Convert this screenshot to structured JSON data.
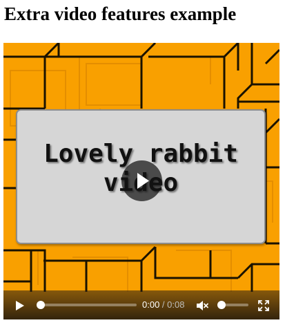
{
  "page": {
    "heading": "Extra video features example"
  },
  "video": {
    "poster_title_line1": "Lovely rabbit",
    "poster_title_line2": "video",
    "colors": {
      "background": "#f9a000",
      "line": "#1a1200",
      "card": "#d6d6d6"
    },
    "controls": {
      "play_icon": "play-icon",
      "current_time": "0:00",
      "separator": " / ",
      "duration": "0:08",
      "progress": 0,
      "muted": true,
      "mute_icon": "speaker-muted-icon",
      "volume": 0,
      "fullscreen_icon": "fullscreen-icon"
    }
  }
}
